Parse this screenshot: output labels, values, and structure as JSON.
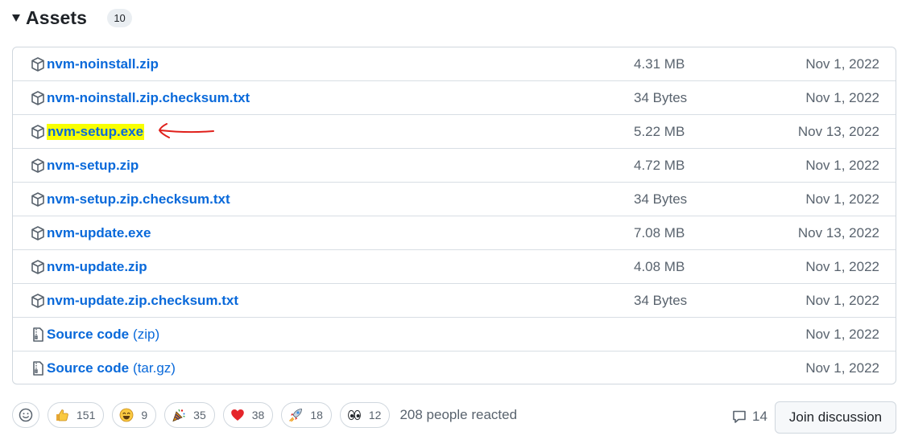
{
  "assets": {
    "title": "Assets",
    "count": "10",
    "items": [
      {
        "name": "nvm-noinstall.zip",
        "size": "4.31 MB",
        "date": "Nov 1, 2022"
      },
      {
        "name": "nvm-noinstall.zip.checksum.txt",
        "size": "34 Bytes",
        "date": "Nov 1, 2022"
      },
      {
        "name": "nvm-setup.exe",
        "size": "5.22 MB",
        "date": "Nov 13, 2022"
      },
      {
        "name": "nvm-setup.zip",
        "size": "4.72 MB",
        "date": "Nov 1, 2022"
      },
      {
        "name": "nvm-setup.zip.checksum.txt",
        "size": "34 Bytes",
        "date": "Nov 1, 2022"
      },
      {
        "name": "nvm-update.exe",
        "size": "7.08 MB",
        "date": "Nov 13, 2022"
      },
      {
        "name": "nvm-update.zip",
        "size": "4.08 MB",
        "date": "Nov 1, 2022"
      },
      {
        "name": "nvm-update.zip.checksum.txt",
        "size": "34 Bytes",
        "date": "Nov 1, 2022"
      },
      {
        "name": "Source code",
        "suffix": "(zip)",
        "date": "Nov 1, 2022"
      },
      {
        "name": "Source code",
        "suffix": "(tar.gz)",
        "date": "Nov 1, 2022"
      }
    ]
  },
  "reactions": {
    "items": [
      {
        "icon": "thumbs-up-icon",
        "count": "151"
      },
      {
        "icon": "laugh-icon",
        "count": "9"
      },
      {
        "icon": "hooray-icon",
        "count": "35"
      },
      {
        "icon": "heart-icon",
        "count": "38"
      },
      {
        "icon": "rocket-icon",
        "count": "18"
      },
      {
        "icon": "eyes-icon",
        "count": "12"
      }
    ],
    "summary": "208 people reacted"
  },
  "discussion": {
    "comment_count": "14",
    "join_label": "Join discussion"
  },
  "colors": {
    "link": "#0969da",
    "highlight": "#f8ff00",
    "annotation": "#e0201b",
    "muted": "#59636e"
  }
}
